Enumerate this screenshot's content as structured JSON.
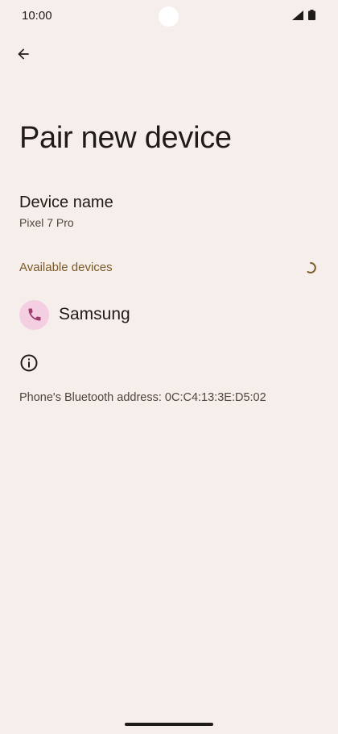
{
  "status_bar": {
    "time": "10:00"
  },
  "header": {
    "back_icon": "arrow-back-icon",
    "title": "Pair new device"
  },
  "device_name": {
    "title": "Device name",
    "value": "Pixel 7 Pro"
  },
  "available_devices": {
    "label": "Available devices",
    "spinner_icon": "loading-spinner-icon",
    "items": [
      {
        "label": "Samsung",
        "icon": "phone-icon"
      }
    ]
  },
  "info": {
    "icon": "info-icon",
    "bluetooth_address": "Phone's Bluetooth address: 0C:C4:13:3E:D5:02"
  },
  "colors": {
    "background": "#f6eeea",
    "accent_label": "#7a5a28",
    "avatar_bg": "#f4cfe2",
    "avatar_icon": "#9c3d6e"
  }
}
